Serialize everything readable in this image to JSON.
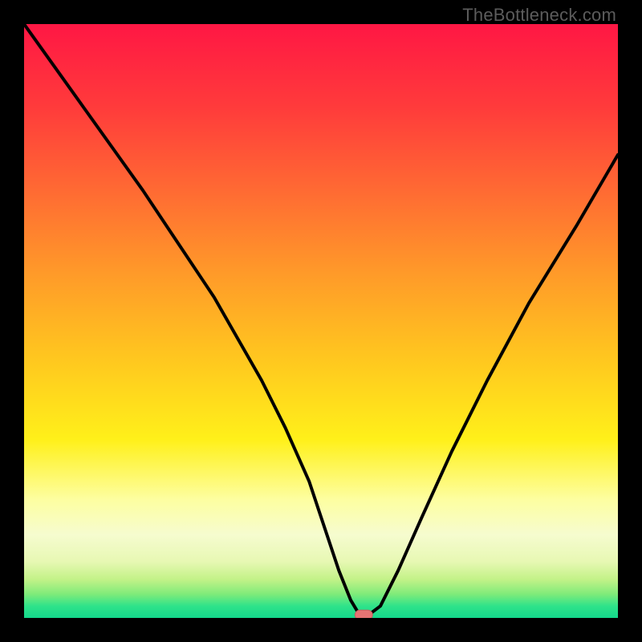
{
  "watermark": "TheBottleneck.com",
  "colors": {
    "black": "#000000",
    "line": "#000000",
    "marker_fill": "#e57373",
    "marker_stroke": "#c36060",
    "gradient_stops": [
      {
        "offset": 0.0,
        "color": "#ff1744"
      },
      {
        "offset": 0.14,
        "color": "#ff3b3b"
      },
      {
        "offset": 0.28,
        "color": "#ff6a33"
      },
      {
        "offset": 0.42,
        "color": "#ff9a29"
      },
      {
        "offset": 0.56,
        "color": "#ffc61f"
      },
      {
        "offset": 0.7,
        "color": "#fff01a"
      },
      {
        "offset": 0.8,
        "color": "#fdfea0"
      },
      {
        "offset": 0.86,
        "color": "#f6fccf"
      },
      {
        "offset": 0.905,
        "color": "#e7f8b3"
      },
      {
        "offset": 0.935,
        "color": "#c3f288"
      },
      {
        "offset": 0.96,
        "color": "#7feb7a"
      },
      {
        "offset": 0.98,
        "color": "#2fe38a"
      },
      {
        "offset": 1.0,
        "color": "#13d88b"
      }
    ]
  },
  "chart_data": {
    "type": "line",
    "title": "",
    "xlabel": "",
    "ylabel": "",
    "xlim": [
      0,
      100
    ],
    "ylim": [
      0,
      100
    ],
    "series": [
      {
        "name": "bottleneck-curve",
        "x": [
          0,
          5,
          10,
          15,
          20,
          24,
          28,
          32,
          36,
          40,
          44,
          48,
          51,
          53,
          55,
          56.5,
          58,
          60,
          63,
          67,
          72,
          78,
          85,
          93,
          100
        ],
        "y": [
          100,
          93,
          86,
          79,
          72,
          66,
          60,
          54,
          47,
          40,
          32,
          23,
          14,
          8,
          3,
          0.5,
          0.5,
          2,
          8,
          17,
          28,
          40,
          53,
          66,
          78
        ]
      }
    ],
    "marker": {
      "x": 57.2,
      "y": 0.5,
      "label": "optimal-point"
    }
  }
}
